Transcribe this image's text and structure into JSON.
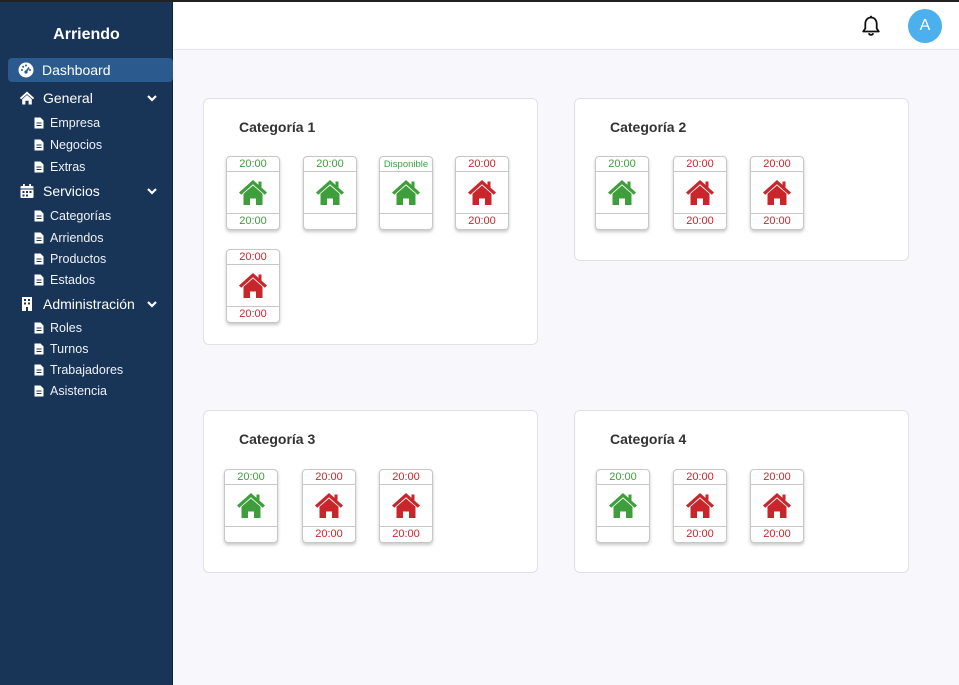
{
  "app": {
    "brand": "Arriendo"
  },
  "sidebar": {
    "dashboard": "Dashboard",
    "groups": [
      {
        "label": "General",
        "items": [
          "Empresa",
          "Negocios",
          "Extras"
        ]
      },
      {
        "label": "Servicios",
        "items": [
          "Categorías",
          "Arriendos",
          "Productos",
          "Estados"
        ]
      },
      {
        "label": "Administración",
        "items": [
          "Roles",
          "Turnos",
          "Trabajadores",
          "Asistencia"
        ]
      }
    ]
  },
  "header": {
    "avatar_initial": "A"
  },
  "colors": {
    "available": "#3e9e3b",
    "occupied": "#c9262c",
    "sidebar": "#183457",
    "accent": "#4db0ee"
  },
  "categories": [
    {
      "title": "Categoría 1",
      "units": [
        {
          "status": "available",
          "top": "20:00",
          "bottom": "20:00"
        },
        {
          "status": "available",
          "top": "20:00",
          "bottom": ""
        },
        {
          "status": "available",
          "top": "Disponible",
          "bottom": ""
        },
        {
          "status": "occupied",
          "top": "20:00",
          "bottom": "20:00"
        },
        {
          "status": "occupied",
          "top": "20:00",
          "bottom": "20:00"
        }
      ]
    },
    {
      "title": "Categoría 2",
      "units": [
        {
          "status": "available",
          "top": "20:00",
          "bottom": ""
        },
        {
          "status": "occupied",
          "top": "20:00",
          "bottom": "20:00"
        },
        {
          "status": "occupied",
          "top": "20:00",
          "bottom": "20:00"
        }
      ]
    },
    {
      "title": "Categoría 3",
      "units": [
        {
          "status": "available",
          "top": "20:00",
          "bottom": ""
        },
        {
          "status": "occupied",
          "top": "20:00",
          "bottom": "20:00"
        },
        {
          "status": "occupied",
          "top": "20:00",
          "bottom": "20:00"
        }
      ]
    },
    {
      "title": "Categoría 4",
      "units": [
        {
          "status": "available",
          "top": "20:00",
          "bottom": ""
        },
        {
          "status": "occupied",
          "top": "20:00",
          "bottom": "20:00"
        },
        {
          "status": "occupied",
          "top": "20:00",
          "bottom": "20:00"
        }
      ]
    }
  ]
}
